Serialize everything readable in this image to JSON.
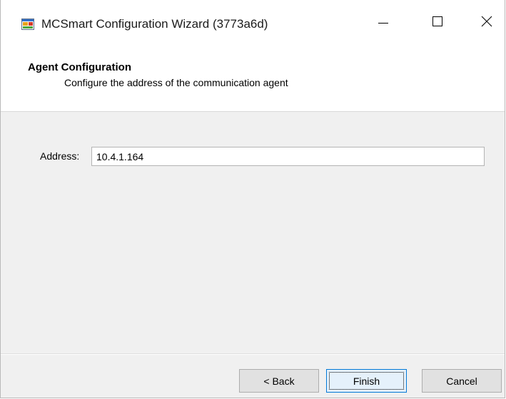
{
  "window": {
    "title": "MCSmart Configuration Wizard (3773a6d)",
    "icon": "app-window-icon"
  },
  "title_buttons": {
    "minimize_icon": "minimize-icon",
    "maximize_icon": "maximize-icon",
    "close_icon": "close-icon"
  },
  "header": {
    "title": "Agent Configuration",
    "subtitle": "Configure the address of the communication agent"
  },
  "form": {
    "address_label": "Address:",
    "address_value": "10.4.1.164"
  },
  "buttons": {
    "back": "< Back",
    "finish": "Finish",
    "cancel": "Cancel"
  },
  "colors": {
    "accent": "#0078d7",
    "panel_bg": "#f0f0f0",
    "header_bg": "#ffffff"
  }
}
